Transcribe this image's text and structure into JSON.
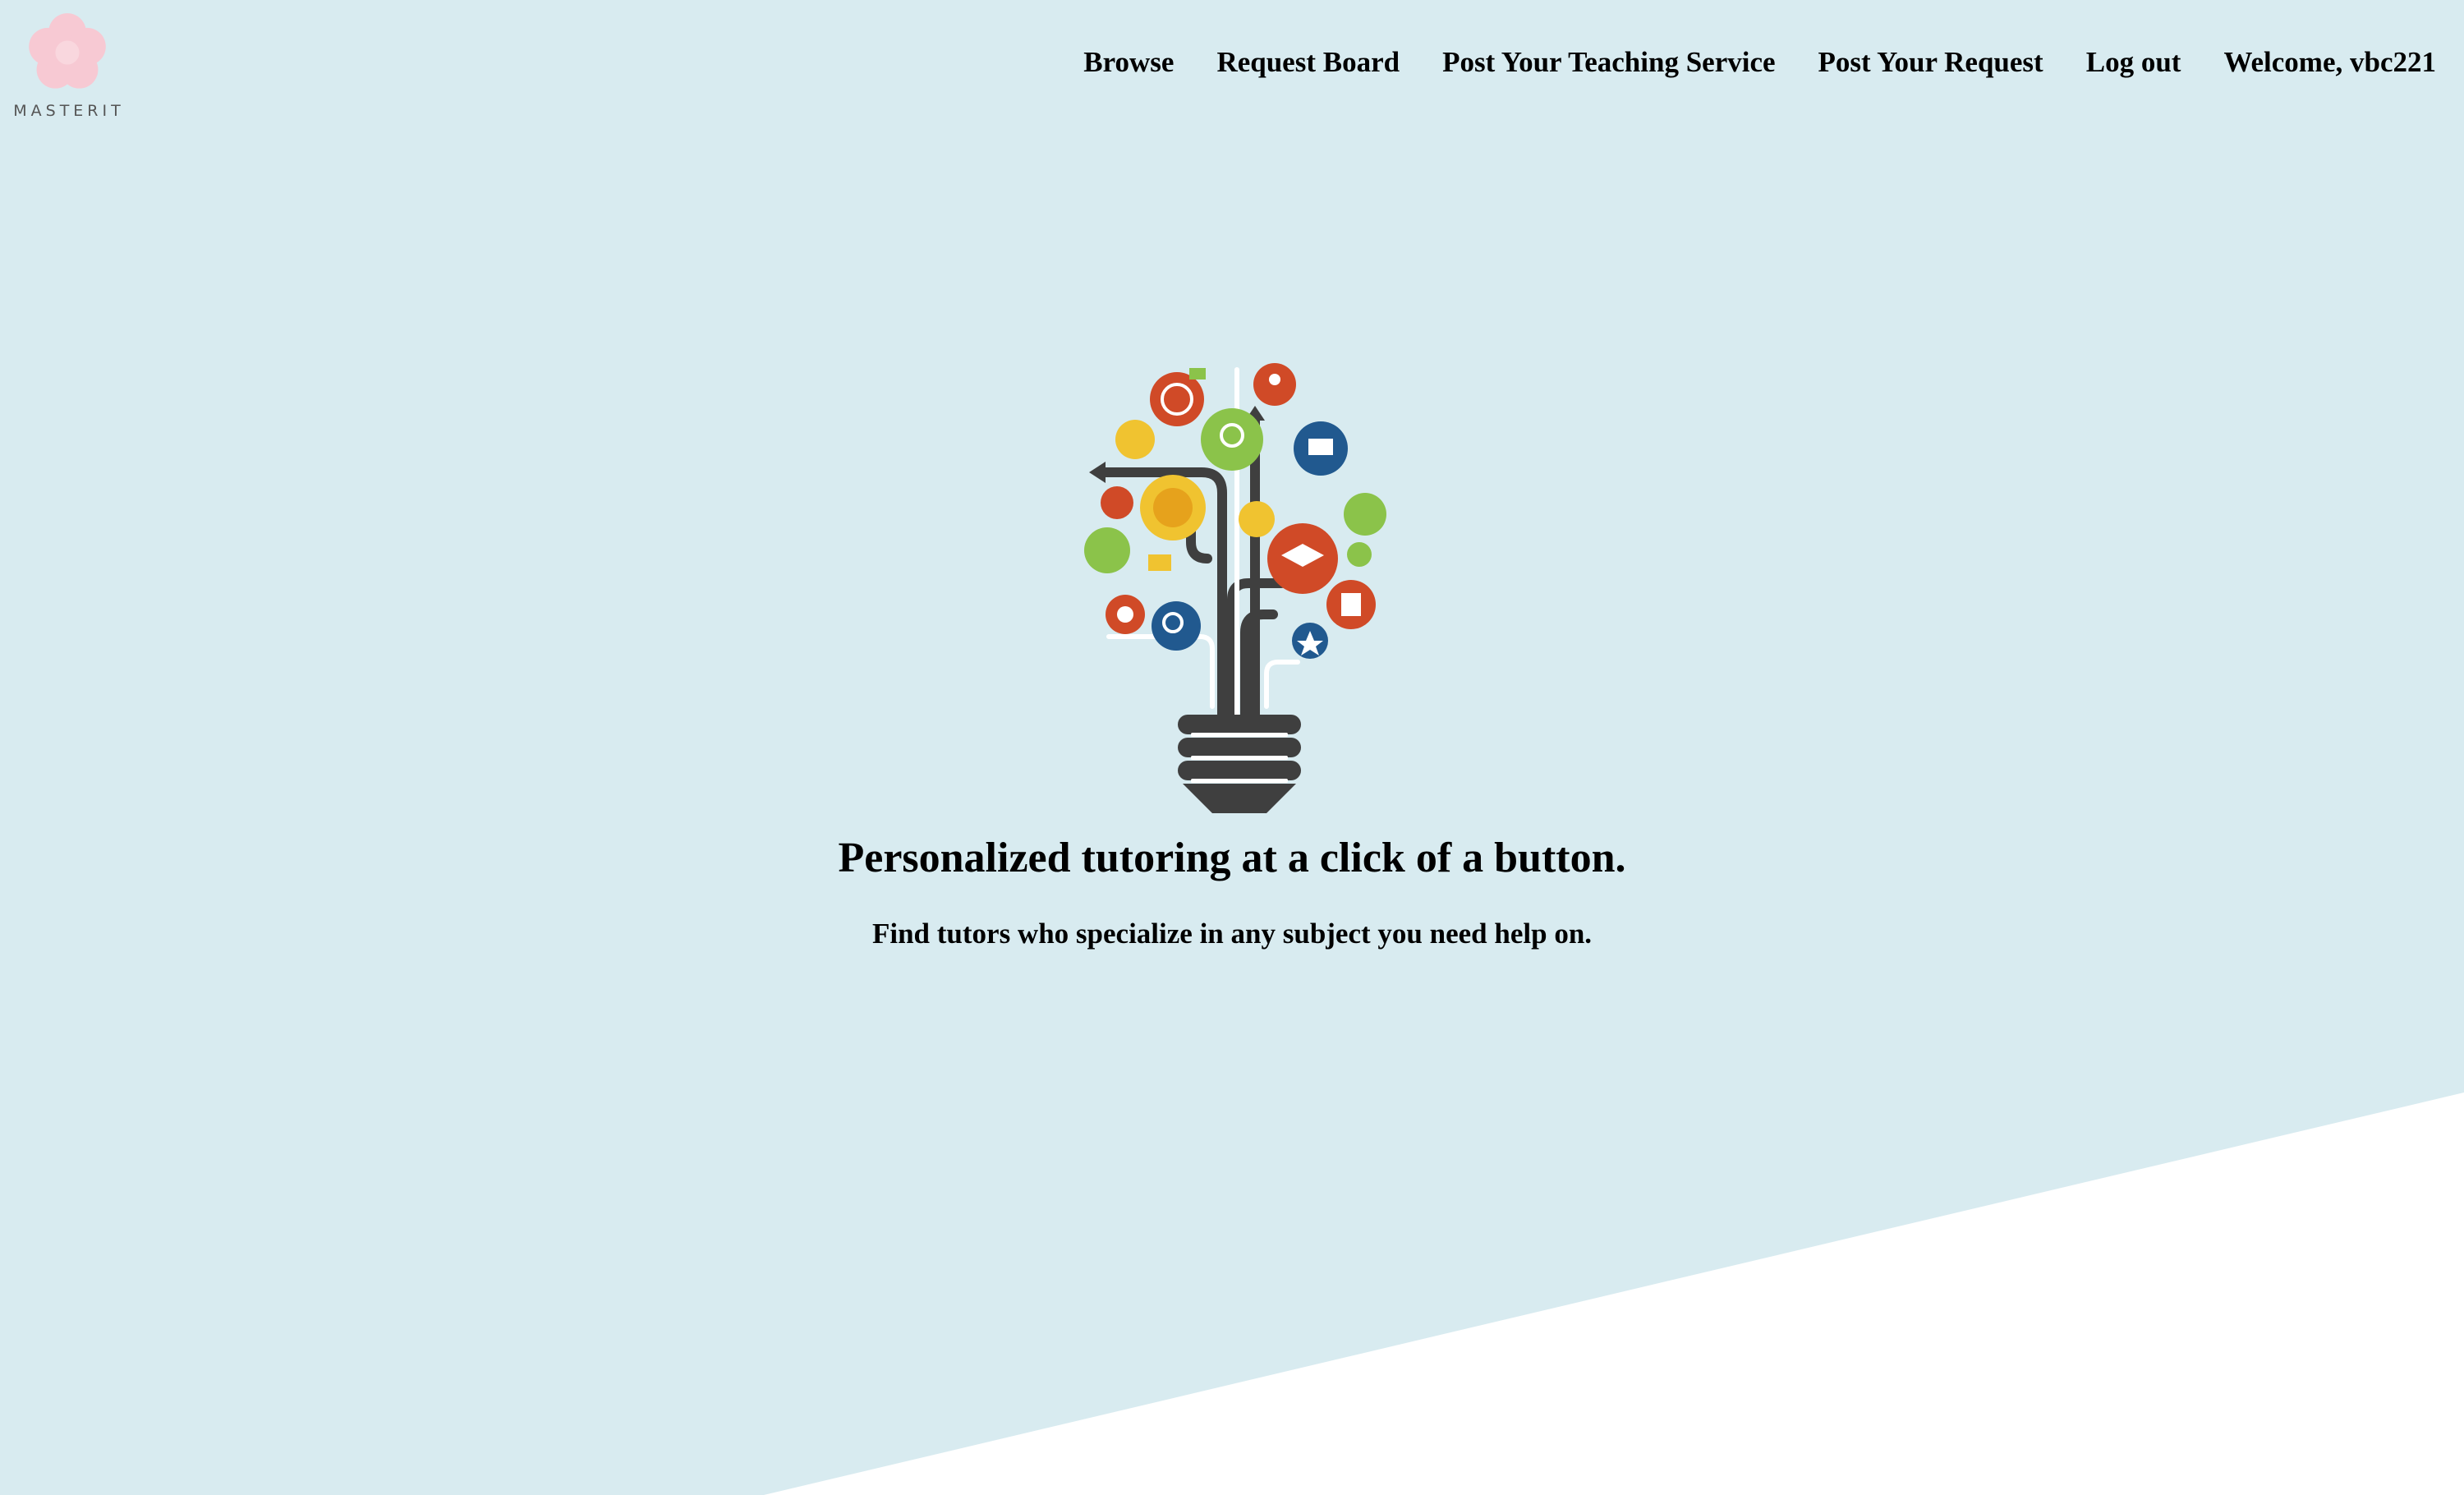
{
  "brand": {
    "name": "MASTERIT"
  },
  "nav": {
    "items": [
      {
        "label": "Browse"
      },
      {
        "label": "Request Board"
      },
      {
        "label": "Post Your Teaching Service"
      },
      {
        "label": "Post Your Request"
      },
      {
        "label": "Log out"
      },
      {
        "label": "Welcome, vbc221"
      }
    ]
  },
  "hero": {
    "illustration": "lightbulb-education-tree-icon",
    "headline": "Personalized tutoring at a click of a button.",
    "subheadline": "Find tutors who specialize in any subject you need help on."
  },
  "colors": {
    "background": "#d8ebf0",
    "wedge": "#ffffff",
    "logo_pink": "#f7c9d3",
    "icon_orange": "#d04a27",
    "icon_green": "#8bc34a",
    "icon_blue": "#21598f",
    "icon_yellow": "#f0c330",
    "bulb_dark": "#3f3f3f"
  }
}
